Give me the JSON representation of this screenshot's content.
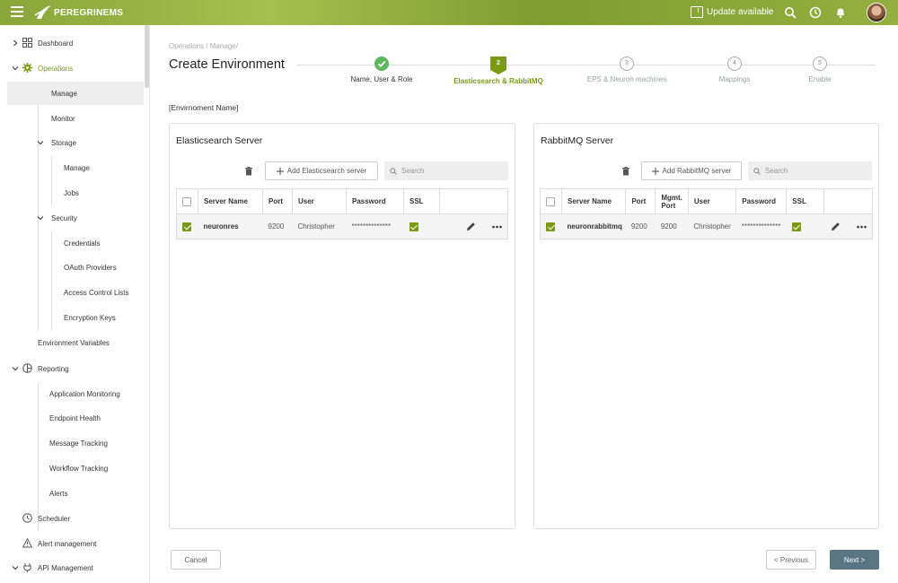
{
  "app": {
    "brand": "PEREGRINEMS",
    "update_label": "Update available"
  },
  "sidebar": {
    "dashboard": "Dashboard",
    "operations": "Operations",
    "manage": "Manage",
    "monitor": "Monitor",
    "storage": "Storage",
    "storage_manage": "Manage",
    "storage_jobs": "Jobs",
    "security": "Security",
    "credentials": "Credentials",
    "oauth": "OAuth Providers",
    "acl": "Access Control Lists",
    "encryption": "Encryption Keys",
    "env_vars": "Environment Variables",
    "reporting": "Reporting",
    "app_monitoring": "Application Monitoring",
    "endpoint_health": "Endpoint Health",
    "message_tracking": "Message Tracking",
    "workflow_tracking": "Workflow Tracking",
    "alerts": "Alerts",
    "scheduler": "Scheduler",
    "alert_mgmt": "Alert management",
    "api_mgmt": "API Management"
  },
  "breadcrumb": "Operations / Manage/",
  "title": "Create Environment",
  "steps": [
    {
      "num": "",
      "label": "Name, User & Role",
      "state": "done"
    },
    {
      "num": "2",
      "label": "Elasticsearch & RabbitMQ",
      "state": "current"
    },
    {
      "num": "3",
      "label": "EPS & Neuron machines",
      "state": "pending"
    },
    {
      "num": "4",
      "label": "Mappings",
      "state": "pending"
    },
    {
      "num": "5",
      "label": "Enable",
      "state": "pending"
    }
  ],
  "env_name": "[Envirnoment Name]",
  "elastic": {
    "title": "Elasticsearch Server",
    "add_label": "Add Elasticsearch server",
    "search_placeholder": "Search",
    "headers": [
      "Server Name",
      "Port",
      "User",
      "Password",
      "SSL"
    ],
    "row": {
      "name": "neuronres",
      "port": "9200",
      "user": "Christopher",
      "password": "**************"
    }
  },
  "rabbit": {
    "title": "RabbitMQ Server",
    "add_label": "Add RabbitMQ server",
    "search_placeholder": "Search",
    "headers": [
      "Server Name",
      "Port",
      "Mgmt. Port",
      "User",
      "Password",
      "SSL"
    ],
    "row": {
      "name": "neuronrabbitmq",
      "port": "9200",
      "mgmt_port": "9200",
      "user": "Christopher",
      "password": "**************"
    }
  },
  "actions": {
    "cancel": "Cancel",
    "previous": "< Previous",
    "next": "Next >"
  },
  "colors": {
    "accent": "#7a9a16",
    "done": "#5cb85c",
    "next_btn": "#5a7583"
  }
}
